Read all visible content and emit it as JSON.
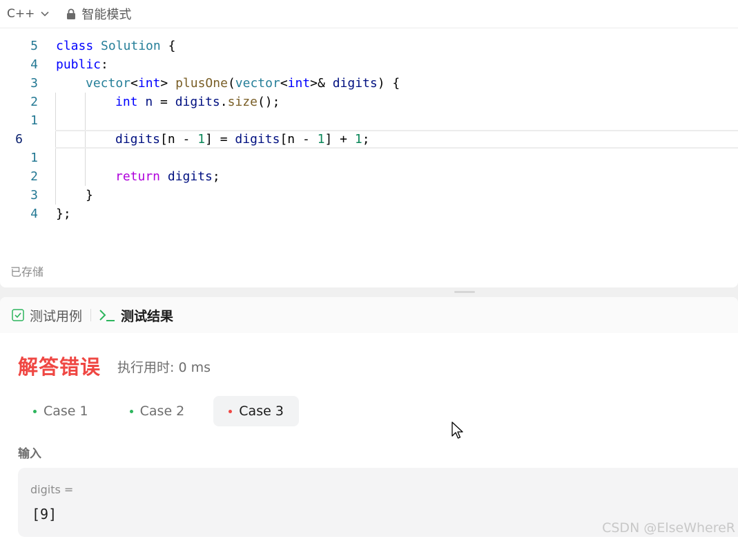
{
  "toolbar": {
    "language": "C++",
    "mode": "智能模式"
  },
  "code": {
    "lines": [
      {
        "num": "5",
        "tokens": [
          [
            "kw",
            "class"
          ],
          [
            "",
            " "
          ],
          [
            "ty",
            "Solution"
          ],
          [
            "",
            " {"
          ]
        ]
      },
      {
        "num": "4",
        "tokens": [
          [
            "kw",
            "public"
          ],
          [
            "",
            ":"
          ]
        ]
      },
      {
        "num": "3",
        "tokens": [
          [
            "ty",
            "vector"
          ],
          [
            "",
            "<"
          ],
          [
            "kw",
            "int"
          ],
          [
            "",
            "> "
          ],
          [
            "fn",
            "plusOne"
          ],
          [
            "",
            "("
          ],
          [
            "ty",
            "vector"
          ],
          [
            "",
            "<"
          ],
          [
            "kw",
            "int"
          ],
          [
            "",
            ">& "
          ],
          [
            "var",
            "digits"
          ],
          [
            "",
            ") {"
          ]
        ]
      },
      {
        "num": "2",
        "tokens": [
          [
            "kw",
            "int"
          ],
          [
            "",
            " "
          ],
          [
            "var",
            "n"
          ],
          [
            "",
            " = "
          ],
          [
            "var",
            "digits"
          ],
          [
            "",
            "."
          ],
          [
            "fn",
            "size"
          ],
          [
            "",
            "();"
          ]
        ]
      },
      {
        "num": "1",
        "tokens": []
      },
      {
        "num": "6",
        "current": true,
        "tokens": [
          [
            "var",
            "digits"
          ],
          [
            "",
            "[n - "
          ],
          [
            "num",
            "1"
          ],
          [
            "",
            "] = "
          ],
          [
            "var",
            "digits"
          ],
          [
            "",
            "[n - "
          ],
          [
            "num",
            "1"
          ],
          [
            "",
            "] + "
          ],
          [
            "num",
            "1"
          ],
          [
            "",
            ";"
          ]
        ]
      },
      {
        "num": "1",
        "tokens": []
      },
      {
        "num": "2",
        "tokens": [
          [
            "ret",
            "return"
          ],
          [
            "",
            " "
          ],
          [
            "var",
            "digits"
          ],
          [
            "",
            ";"
          ]
        ]
      },
      {
        "num": "3",
        "tokens": [
          [
            "",
            "}"
          ]
        ]
      },
      {
        "num": "4",
        "tokens": [
          [
            "",
            "};"
          ]
        ]
      }
    ],
    "indents": [
      0,
      0,
      1,
      2,
      0,
      2,
      0,
      2,
      1,
      0
    ]
  },
  "status": {
    "saved": "已存储"
  },
  "result": {
    "tab_testcase": "测试用例",
    "tab_result": "测试结果",
    "verdict": "解答错误",
    "runtime": "执行用时: 0 ms",
    "cases": [
      {
        "label": "Case 1",
        "status": "pass",
        "selected": false
      },
      {
        "label": "Case 2",
        "status": "pass",
        "selected": false
      },
      {
        "label": "Case 3",
        "status": "fail",
        "selected": true
      }
    ],
    "input_label": "输入",
    "input_name": "digits =",
    "input_value": "[9]"
  },
  "colors": {
    "pass": "#2db55d",
    "fail": "#ef4743",
    "verdict": "#ef4743"
  },
  "watermark": "CSDN @ElseWhereR"
}
